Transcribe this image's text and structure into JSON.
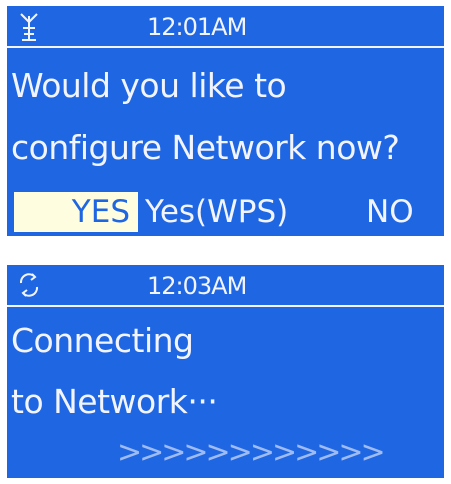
{
  "screens": [
    {
      "status_icon": "antenna-icon",
      "time": "12:01AM",
      "lines": [
        "Would you like to",
        "configure Network now?"
      ],
      "options": [
        {
          "label": "YES",
          "selected": true
        },
        {
          "label": "Yes(WPS)",
          "selected": false
        },
        {
          "label": "NO",
          "selected": false
        }
      ]
    },
    {
      "status_icon": "refresh-icon",
      "time": "12:03AM",
      "lines": [
        "Connecting",
        "to Network···"
      ],
      "progress_text": ">>>>>>>>>>>>"
    }
  ],
  "colors": {
    "screen_background": "#1f66e2",
    "text": "#f2f4ff",
    "selection_highlight": "#fffde0",
    "progress": "#9fbbf2"
  }
}
